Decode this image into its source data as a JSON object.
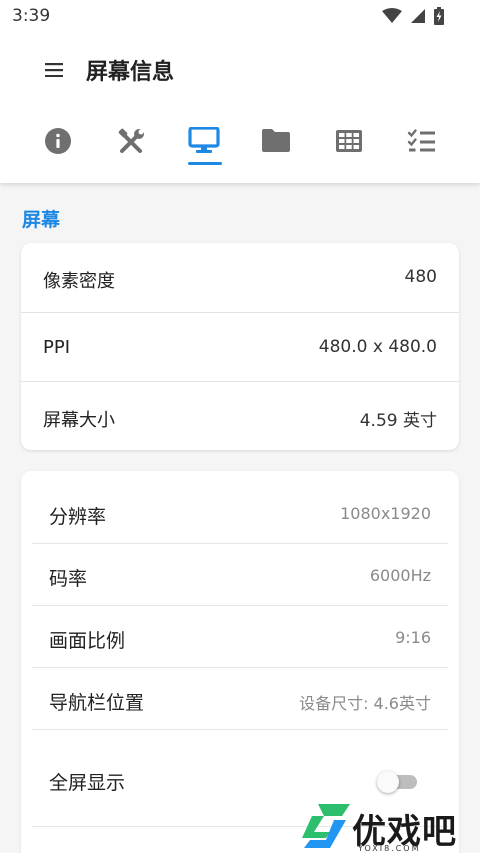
{
  "status_bar": {
    "time": "3:39",
    "icons": [
      "wifi-icon",
      "cell-signal-icon",
      "battery-charging-icon"
    ]
  },
  "app_bar": {
    "menu_icon": "hamburger-menu-icon",
    "title": "屏幕信息"
  },
  "tabs": [
    {
      "icon": "info-icon",
      "active": false
    },
    {
      "icon": "tools-icon",
      "active": false
    },
    {
      "icon": "monitor-icon",
      "active": true
    },
    {
      "icon": "folder-icon",
      "active": false
    },
    {
      "icon": "grid-icon",
      "active": false
    },
    {
      "icon": "checklist-icon",
      "active": false
    }
  ],
  "section": {
    "title": "屏幕"
  },
  "card1": {
    "rows": [
      {
        "label": "像素密度",
        "value": "480"
      },
      {
        "label": "PPI",
        "value": "480.0 x 480.0"
      },
      {
        "label": "屏幕大小",
        "value": "4.59 英寸"
      }
    ]
  },
  "card2": {
    "rows": [
      {
        "label": "分辨率",
        "value": "1080x1920"
      },
      {
        "label": "码率",
        "value": "6000Hz"
      },
      {
        "label": "画面比例",
        "value": "9:16"
      },
      {
        "label": "导航栏位置",
        "value": "设备尺寸: 4.6英寸"
      }
    ],
    "toggle": {
      "label": "全屏显示",
      "checked": false
    }
  },
  "colors": {
    "accent": "#1e88e5",
    "icon_inactive": "#6f6f6f",
    "background": "#f5f5f5",
    "watermark_green": "#2dbf6e",
    "watermark_blue": "#2196f3"
  },
  "watermark": {
    "text": "优戏吧",
    "sub": "YOXI8.COM"
  }
}
